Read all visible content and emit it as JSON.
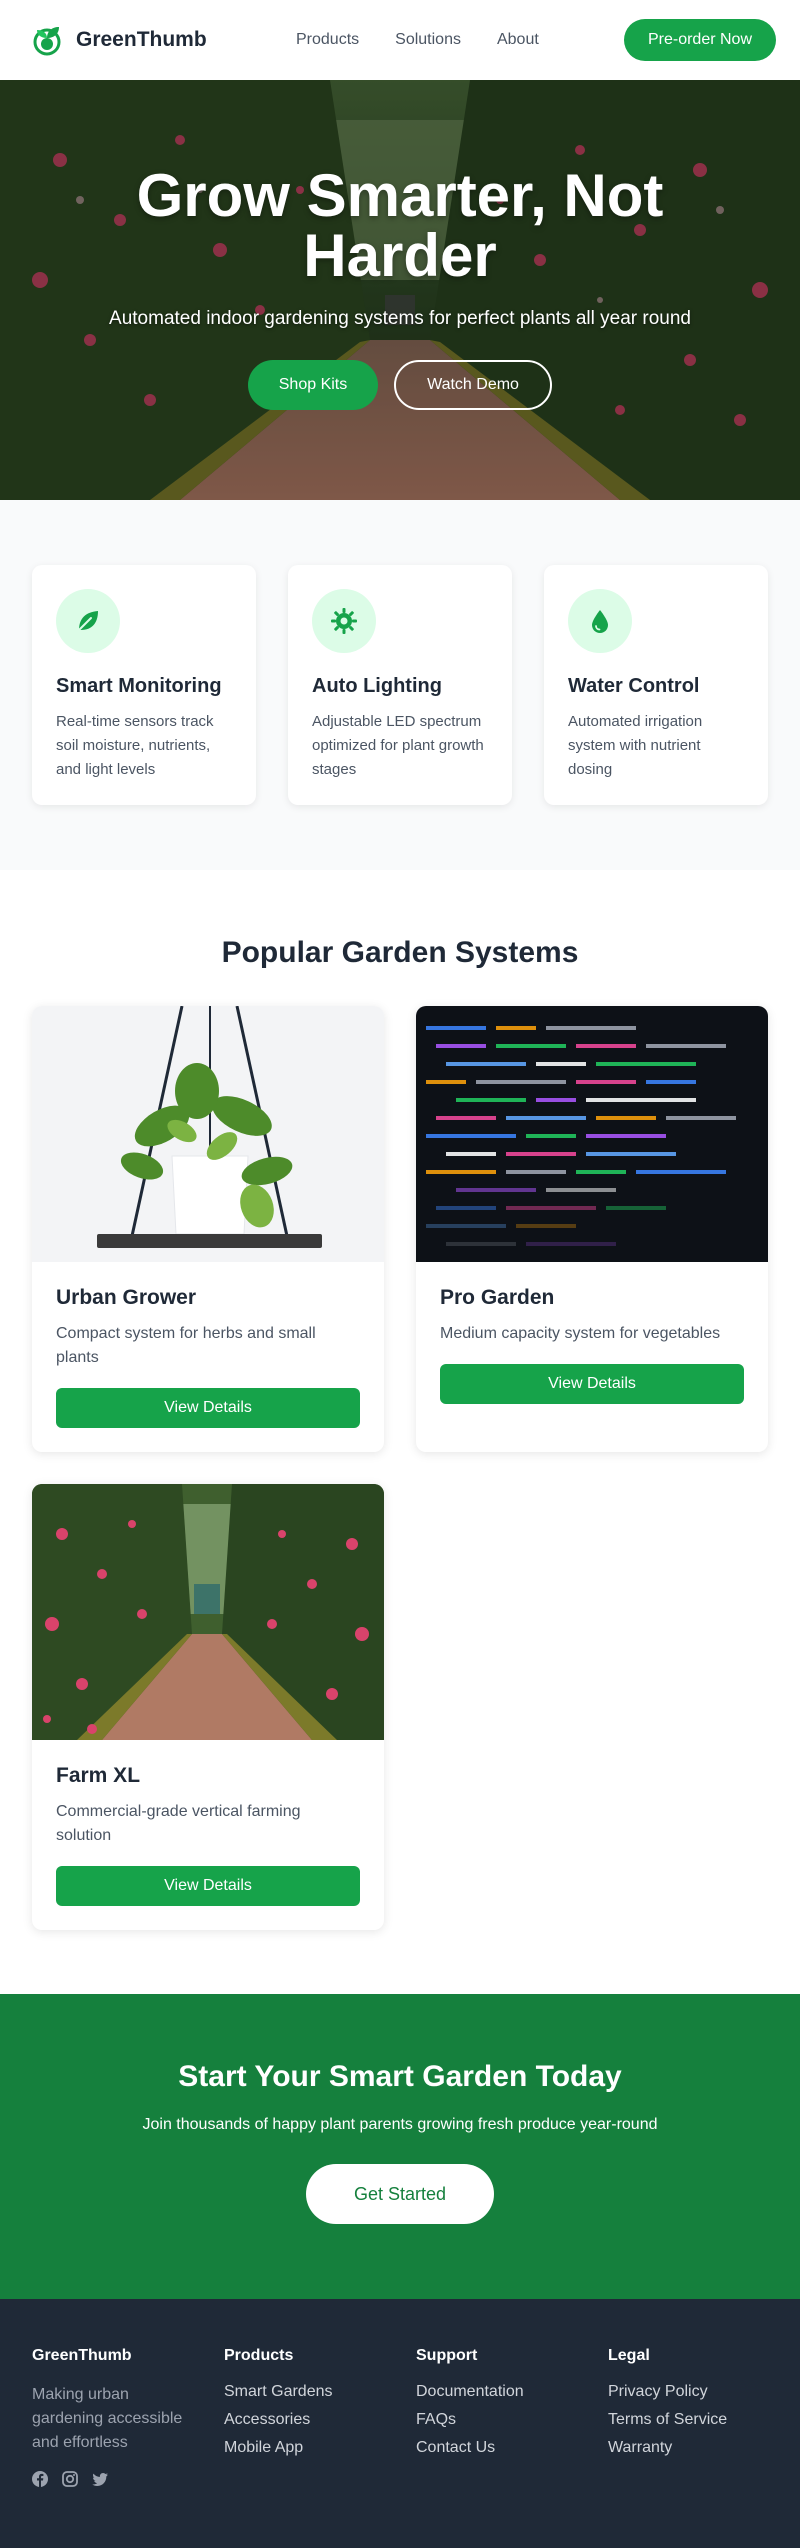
{
  "nav": {
    "brand": "GreenThumb",
    "logo_icon": "leaf-logo-icon",
    "links": [
      "Products",
      "Solutions",
      "About"
    ],
    "cta": "Pre-order Now"
  },
  "hero": {
    "title": "Grow Smarter, Not Harder",
    "subtitle": "Automated indoor gardening systems for perfect plants all year round",
    "primary": "Shop Kits",
    "secondary": "Watch Demo"
  },
  "features": [
    {
      "icon": "leaf-icon",
      "title": "Smart Monitoring",
      "desc": "Real-time sensors track soil moisture, nutrients, and light levels"
    },
    {
      "icon": "sun-icon",
      "title": "Auto Lighting",
      "desc": "Adjustable LED spectrum optimized for plant growth stages"
    },
    {
      "icon": "droplet-icon",
      "title": "Water Control",
      "desc": "Automated irrigation system with nutrient dosing"
    }
  ],
  "products": {
    "title": "Popular Garden Systems",
    "items": [
      {
        "name": "Urban Grower",
        "desc": "Compact system for herbs and small plants",
        "button": "View Details"
      },
      {
        "name": "Pro Garden",
        "desc": "Medium capacity system for vegetables",
        "button": "View Details"
      },
      {
        "name": "Farm XL",
        "desc": "Commercial-grade vertical farming solution",
        "button": "View Details"
      }
    ]
  },
  "cta": {
    "title": "Start Your Smart Garden Today",
    "subtitle": "Join thousands of happy plant parents growing fresh produce year-round",
    "button": "Get Started"
  },
  "footer": {
    "brand": "GreenThumb",
    "about": "Making urban gardening accessible and effortless",
    "social": [
      "facebook-icon",
      "instagram-icon",
      "twitter-icon"
    ],
    "columns": [
      {
        "title": "Products",
        "links": [
          "Smart Gardens",
          "Accessories",
          "Mobile App"
        ]
      },
      {
        "title": "Support",
        "links": [
          "Documentation",
          "FAQs",
          "Contact Us"
        ]
      },
      {
        "title": "Legal",
        "links": [
          "Privacy Policy",
          "Terms of Service",
          "Warranty"
        ]
      }
    ]
  },
  "colors": {
    "primary": "#16a34a",
    "cta_bg": "#15803d",
    "footer_bg": "#1f2937",
    "feature_icon_bg": "#dcfce7"
  }
}
